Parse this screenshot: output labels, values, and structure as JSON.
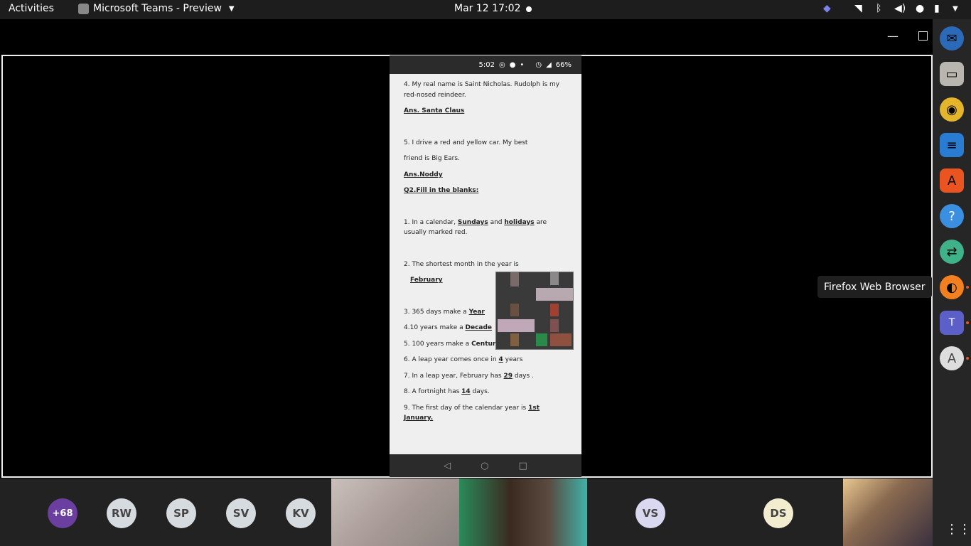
{
  "topbar": {
    "activities": "Activities",
    "app_name": "Microsoft Teams - Preview",
    "clock": "Mar 12  17:02"
  },
  "phone": {
    "status": {
      "time": "5:02",
      "battery": "66%"
    },
    "lines": [
      "4. My real name is Saint Nicholas. Rudolph is my red-nosed reindeer.",
      "Ans. Santa Claus",
      "5. I drive a red and yellow car. My best",
      "friend is Big Ears.",
      "Ans.Noddy",
      "Q2.Fill in the blanks:",
      "1. In a calendar,",
      "Sundays",
      "and",
      "holidays",
      "are usually marked red.",
      "2. The shortest month in the year is",
      "February",
      "3. 365 days make a",
      "Year",
      "4.10 years make a",
      "Decade",
      "5. 100 years make a",
      "Century",
      "6. A leap year comes once in",
      "4",
      "years",
      "7. In a leap year, February has",
      "29",
      "days .",
      "8. A fortnight has",
      "14",
      "days.",
      "9. The first day of the calendar year is",
      "1st January."
    ]
  },
  "dock": {
    "tooltip": "Firefox Web Browser",
    "items": [
      {
        "name": "thunderbird-icon",
        "color": "#2a6ab8"
      },
      {
        "name": "files-icon",
        "color": "#b9b6b0"
      },
      {
        "name": "rhythmbox-icon",
        "color": "#e4b52b"
      },
      {
        "name": "libreoffice-writer-icon",
        "color": "#2a7cd3"
      },
      {
        "name": "software-icon",
        "color": "#e95420"
      },
      {
        "name": "help-icon",
        "color": "#3a8fe0"
      },
      {
        "name": "remote-desktop-icon",
        "color": "#3fb28a"
      },
      {
        "name": "firefox-icon",
        "color": "#f27f20"
      },
      {
        "name": "teams-icon",
        "color": "#5b5fc7"
      },
      {
        "name": "software-updater-icon",
        "color": "#dddddd"
      }
    ]
  },
  "participants": {
    "overflow": "+68",
    "avatars": [
      "RW",
      "SP",
      "SV",
      "KV"
    ],
    "avatar2": [
      "VS",
      "DS"
    ]
  },
  "colors": {
    "overflow_bg": "#6b3fa0",
    "avatar_bg": "#d6dbe0",
    "vs_bg": "#d8d8f0",
    "ds_bg": "#f3edd0"
  }
}
